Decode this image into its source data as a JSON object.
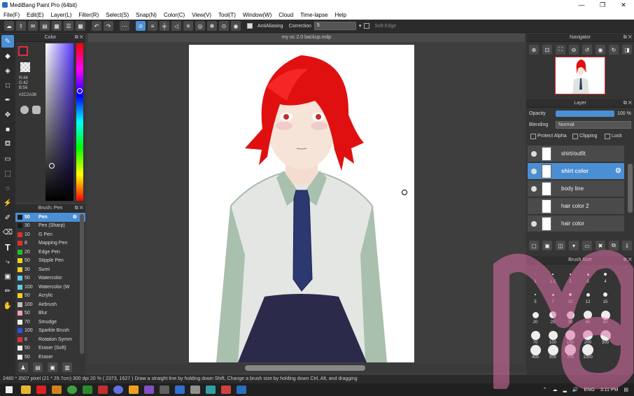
{
  "window": {
    "title": "MediBang Paint Pro (64bit)",
    "controls": [
      "—",
      "❐",
      "✕"
    ]
  },
  "menu": [
    "File(F)",
    "Edit(E)",
    "Layer(L)",
    "Filter(R)",
    "Select(S)",
    "Snap(N)",
    "Color(C)",
    "View(V)",
    "Tool(T)",
    "Window(W)",
    "Cloud",
    "Time-lapse",
    "Help"
  ],
  "toolbar": {
    "antialiasing": "AntiAliasing",
    "correction_label": "Correction",
    "correction_value": "5",
    "softedge": "Soft Edge"
  },
  "color_panel": {
    "title": "Color",
    "r": "R:44",
    "g": "G:42",
    "b": "B:56",
    "hex": "#2C2A38",
    "fg": "#2c2a38",
    "bg": "#ffffff"
  },
  "brush_panel": {
    "title": "Brush: Pen",
    "items": [
      {
        "num": "50",
        "name": "Pen",
        "color": "#1a1a1a",
        "sel": true
      },
      {
        "num": "30",
        "name": "Pen (Sharp)",
        "color": "#1a1a1a"
      },
      {
        "num": "10",
        "name": "G Pen",
        "color": "#e03030"
      },
      {
        "num": "8",
        "name": "Mapping Pen",
        "color": "#e03030"
      },
      {
        "num": "20",
        "name": "Edge Pen",
        "color": "#20c020"
      },
      {
        "num": "50",
        "name": "Stipple Pen",
        "color": "#f0d020"
      },
      {
        "num": "30",
        "name": "Sumi",
        "color": "#f0d020"
      },
      {
        "num": "50",
        "name": "Watercolor",
        "color": "#60c8f0"
      },
      {
        "num": "100",
        "name": "Watercolor (W",
        "color": "#60c8f0"
      },
      {
        "num": "50",
        "name": "Acrylic",
        "color": "#f0d020"
      },
      {
        "num": "100",
        "name": "Airbrush",
        "color": "#c0c0c0"
      },
      {
        "num": "50",
        "name": "Blur",
        "color": "#f0a0c0"
      },
      {
        "num": "70",
        "name": "Smudge",
        "color": "#f0f0f0"
      },
      {
        "num": "100",
        "name": "Sparkle Brush",
        "color": "#3050e0"
      },
      {
        "num": "8",
        "name": "Rotation Symm",
        "color": "#e03030"
      },
      {
        "num": "50",
        "name": "Eraser (Soft)",
        "color": "#f0f0f0"
      },
      {
        "num": "50",
        "name": "Eraser",
        "color": "#f0f0f0"
      }
    ]
  },
  "document": {
    "tab": "my oc 2.0 backup.mdp"
  },
  "navigator": {
    "title": "Navigator"
  },
  "layer_panel": {
    "title": "Layer",
    "opacity_label": "Opacity",
    "opacity_value": "100 %",
    "blending_label": "Blending",
    "blending_value": "Normal",
    "protect_alpha": "Protect Alpha",
    "clipping": "Clipping",
    "lock": "Lock",
    "layers": [
      {
        "name": "shirt/outfit",
        "visible": true,
        "selected": false
      },
      {
        "name": "shirt color",
        "visible": true,
        "selected": true
      },
      {
        "name": "body line",
        "visible": true,
        "selected": false
      },
      {
        "name": "hair color 2",
        "visible": false,
        "selected": false
      },
      {
        "name": "hair color",
        "visible": true,
        "selected": false
      }
    ]
  },
  "brush_size": {
    "title": "Brush Size",
    "sizes": [
      "1",
      "1.5",
      "2",
      "3",
      "4",
      "5",
      "7",
      "10",
      "12",
      "15",
      "20",
      "25",
      "30",
      "40",
      "50",
      "70",
      "100",
      "150",
      "200",
      "300",
      "400",
      "500",
      "700",
      "1000"
    ]
  },
  "status": {
    "text": "2480 * 3507 pixel   (21 * 29.7cm)   300 dpi   20 %   ( 2373, 1627 )   Draw a straight line by holding down Shift, Change a brush size by holding down Ctrl, Alt, and dragging"
  },
  "taskbar": {
    "lang": "ENG",
    "time": "3:11 PM"
  }
}
